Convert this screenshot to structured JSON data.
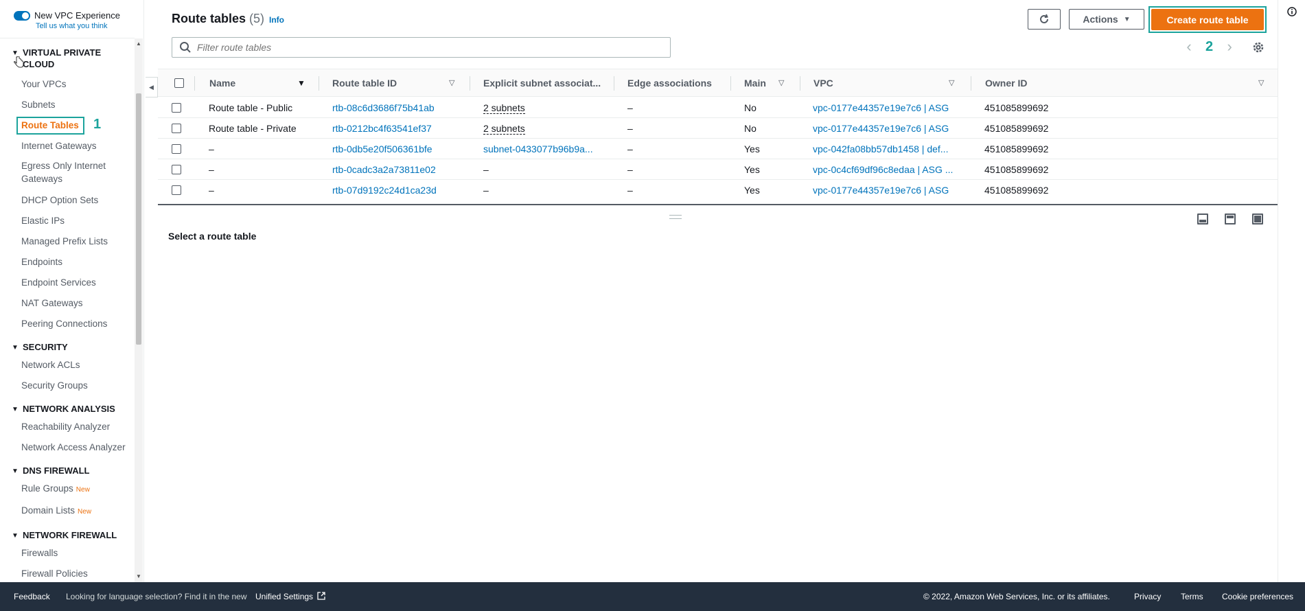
{
  "sidebar": {
    "toggle_title": "New VPC Experience",
    "toggle_sub": "Tell us what you think",
    "sections": [
      {
        "title": "VIRTUAL PRIVATE CLOUD"
      },
      {
        "title": "SECURITY"
      },
      {
        "title": "NETWORK ANALYSIS"
      },
      {
        "title": "DNS FIREWALL"
      },
      {
        "title": "NETWORK FIREWALL"
      }
    ],
    "items": {
      "your_vpcs": "Your VPCs",
      "subnets": "Subnets",
      "route_tables": "Route Tables",
      "internet_gateways": "Internet Gateways",
      "egress_only": "Egress Only Internet Gateways",
      "dhcp": "DHCP Option Sets",
      "elastic_ips": "Elastic IPs",
      "prefix_lists": "Managed Prefix Lists",
      "endpoints": "Endpoints",
      "endpoint_services": "Endpoint Services",
      "nat_gateways": "NAT Gateways",
      "peering": "Peering Connections",
      "network_acls": "Network ACLs",
      "security_groups": "Security Groups",
      "reachability": "Reachability Analyzer",
      "network_access": "Network Access Analyzer",
      "rule_groups": "Rule Groups",
      "domain_lists": "Domain Lists",
      "firewalls": "Firewalls",
      "firewall_policies": "Firewall Policies"
    },
    "new_badge": "New",
    "annotation_1": "1"
  },
  "header": {
    "title": "Route tables",
    "count": "(5)",
    "info": "Info",
    "actions_label": "Actions",
    "create_label": "Create route table",
    "annotation_2": "2",
    "filter_placeholder": "Filter route tables"
  },
  "table": {
    "columns": [
      "Name",
      "Route table ID",
      "Explicit subnet associat...",
      "Edge associations",
      "Main",
      "VPC",
      "Owner ID"
    ],
    "rows": [
      {
        "name": "Route table - Public",
        "id": "rtb-08c6d3686f75b41ab",
        "subnet": "2 subnets",
        "edge": "–",
        "main": "No",
        "vpc": "vpc-0177e44357e19e7c6 | ASG",
        "owner": "451085899692"
      },
      {
        "name": "Route table - Private",
        "id": "rtb-0212bc4f63541ef37",
        "subnet": "2 subnets",
        "edge": "–",
        "main": "No",
        "vpc": "vpc-0177e44357e19e7c6 | ASG",
        "owner": "451085899692"
      },
      {
        "name": "–",
        "id": "rtb-0db5e20f506361bfe",
        "subnet": "subnet-0433077b96b9a...",
        "edge": "–",
        "main": "Yes",
        "vpc": "vpc-042fa08bb57db1458 | def...",
        "owner": "451085899692"
      },
      {
        "name": "–",
        "id": "rtb-0cadc3a2a73811e02",
        "subnet": "–",
        "edge": "–",
        "main": "Yes",
        "vpc": "vpc-0c4cf69df96c8edaa | ASG ...",
        "owner": "451085899692"
      },
      {
        "name": "–",
        "id": "rtb-07d9192c24d1ca23d",
        "subnet": "–",
        "edge": "–",
        "main": "Yes",
        "vpc": "vpc-0177e44357e19e7c6 | ASG",
        "owner": "451085899692"
      }
    ]
  },
  "panel": {
    "message": "Select a route table"
  },
  "footer": {
    "feedback": "Feedback",
    "language_msg": "Looking for language selection? Find it in the new",
    "unified": "Unified Settings",
    "copyright": "© 2022, Amazon Web Services, Inc. or its affiliates.",
    "privacy": "Privacy",
    "terms": "Terms",
    "cookies": "Cookie preferences"
  },
  "colors": {
    "accent": "#ec7211",
    "link": "#0073bb",
    "annotation": "#1ba39c",
    "footer_bg": "#232f3e"
  }
}
